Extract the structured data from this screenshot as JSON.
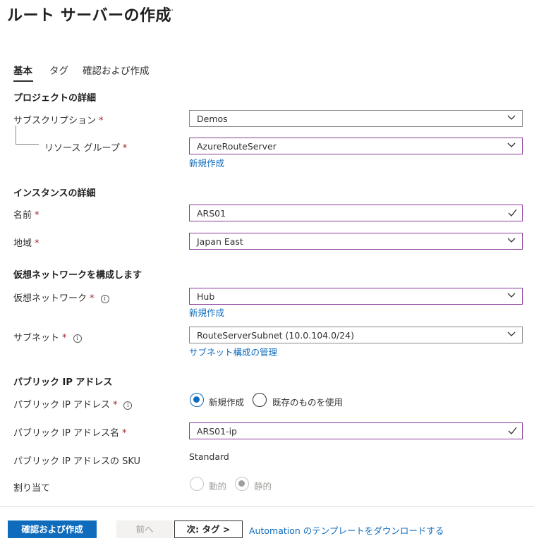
{
  "page": {
    "title": "ルート サーバーの作成",
    "more": "···"
  },
  "tabs": [
    {
      "label": "基本",
      "active": true
    },
    {
      "label": "タグ",
      "active": false
    },
    {
      "label": "確認および作成",
      "active": false
    }
  ],
  "project": {
    "heading": "プロジェクトの詳細",
    "subscription": {
      "label": "サブスクリプション",
      "value": "Demos"
    },
    "resource_group": {
      "label": "リソース グループ",
      "value": "AzureRouteServer",
      "create_new": "新規作成"
    }
  },
  "instance": {
    "heading": "インスタンスの詳細",
    "name": {
      "label": "名前",
      "value": "ARS01"
    },
    "region": {
      "label": "地域",
      "value": "Japan East"
    }
  },
  "vnet": {
    "heading": "仮想ネットワークを構成します",
    "network": {
      "label": "仮想ネットワーク",
      "value": "Hub",
      "create_new": "新規作成"
    },
    "subnet": {
      "label": "サブネット",
      "value": "RouteServerSubnet (10.0.104.0/24)",
      "manage": "サブネット構成の管理"
    }
  },
  "public_ip": {
    "heading": "パブリック IP アドレス",
    "address": {
      "label": "パブリック IP アドレス",
      "options": [
        "新規作成",
        "既存のものを使用"
      ],
      "selected": "新規作成"
    },
    "name": {
      "label": "パブリック IP アドレス名",
      "value": "ARS01-ip"
    },
    "sku": {
      "label": "パブリック IP アドレスの SKU",
      "value": "Standard"
    },
    "assignment": {
      "label": "割り当て",
      "options": [
        "動的",
        "静的"
      ],
      "selected": "静的"
    }
  },
  "required_marker": "*",
  "footer": {
    "review_create": "確認および作成",
    "previous": "前へ",
    "next": "次: タグ >",
    "download_link": "Automation のテンプレートをダウンロードする"
  },
  "colors": {
    "accent": "#0f6cbd",
    "required": "#a4262c",
    "valid_border": "#8a3a9b"
  }
}
